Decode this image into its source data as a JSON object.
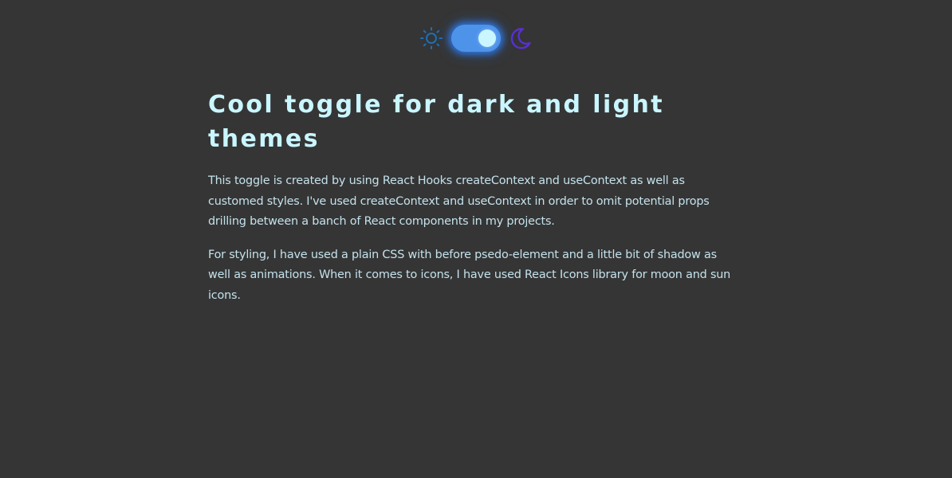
{
  "theme_toggle": {
    "left_icon": "sun-icon",
    "right_icon": "moon-icon",
    "state": "dark",
    "colors": {
      "sun": "#1d6fb8",
      "switch_track": "#4e93ea",
      "switch_knob": "#c9f6ff",
      "moon": "#5a2fd4"
    }
  },
  "article": {
    "title": "Cool toggle for dark and light themes",
    "paragraphs": [
      "This toggle is created by using React Hooks createContext and useContext as well as customed styles. I've used createContext and useContext in order to omit potential props drilling between a banch of React components in my projects.",
      "For styling, I have used a plain CSS with before psedo-element and a little bit of shadow as well as animations. When it comes to icons, I have used React Icons library for moon and sun icons."
    ]
  },
  "colors": {
    "background": "#353535",
    "title": "#c9f6ff",
    "text": "#c4e2ec"
  }
}
